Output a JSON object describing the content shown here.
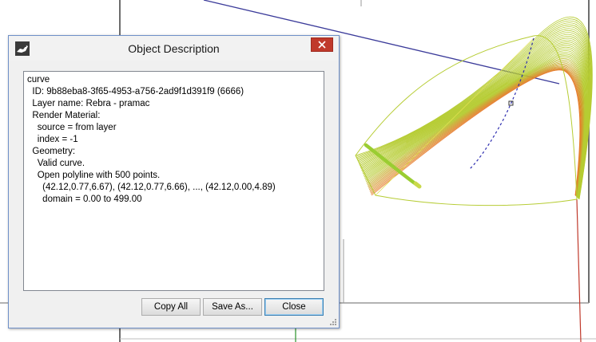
{
  "dialog": {
    "title": "Object Description",
    "lines": [
      "curve",
      "  ID: 9b88eba8-3f65-4953-a756-2ad9f1d391f9 (6666)",
      "  Layer name: Rebra - pramac",
      "  Render Material:",
      "    source = from layer",
      "    index = -1",
      "  Geometry:",
      "    Valid curve.",
      "    Open polyline with 500 points.",
      "      (42.12,0.77,6.67), (42.12,0.77,6.66), ..., (42.12,0.00,4.89)",
      "      domain = 0.00 to 499.00"
    ],
    "buttons": {
      "copy_all": "Copy All",
      "save_as": "Save As...",
      "close": "Close"
    },
    "icons": {
      "app": "rhino-app-icon",
      "close": "close-x-icon",
      "resize": "resize-grip-icon"
    }
  },
  "colors": {
    "surface_wire": "#b6cc33",
    "surface_warm": "#e67a2a",
    "highlight_curve": "#9acd32",
    "axis_blue": "#3b3b9a",
    "axis_red": "#c0392b",
    "axis_green": "#3a9a3a",
    "close_button": "#c0392b"
  }
}
